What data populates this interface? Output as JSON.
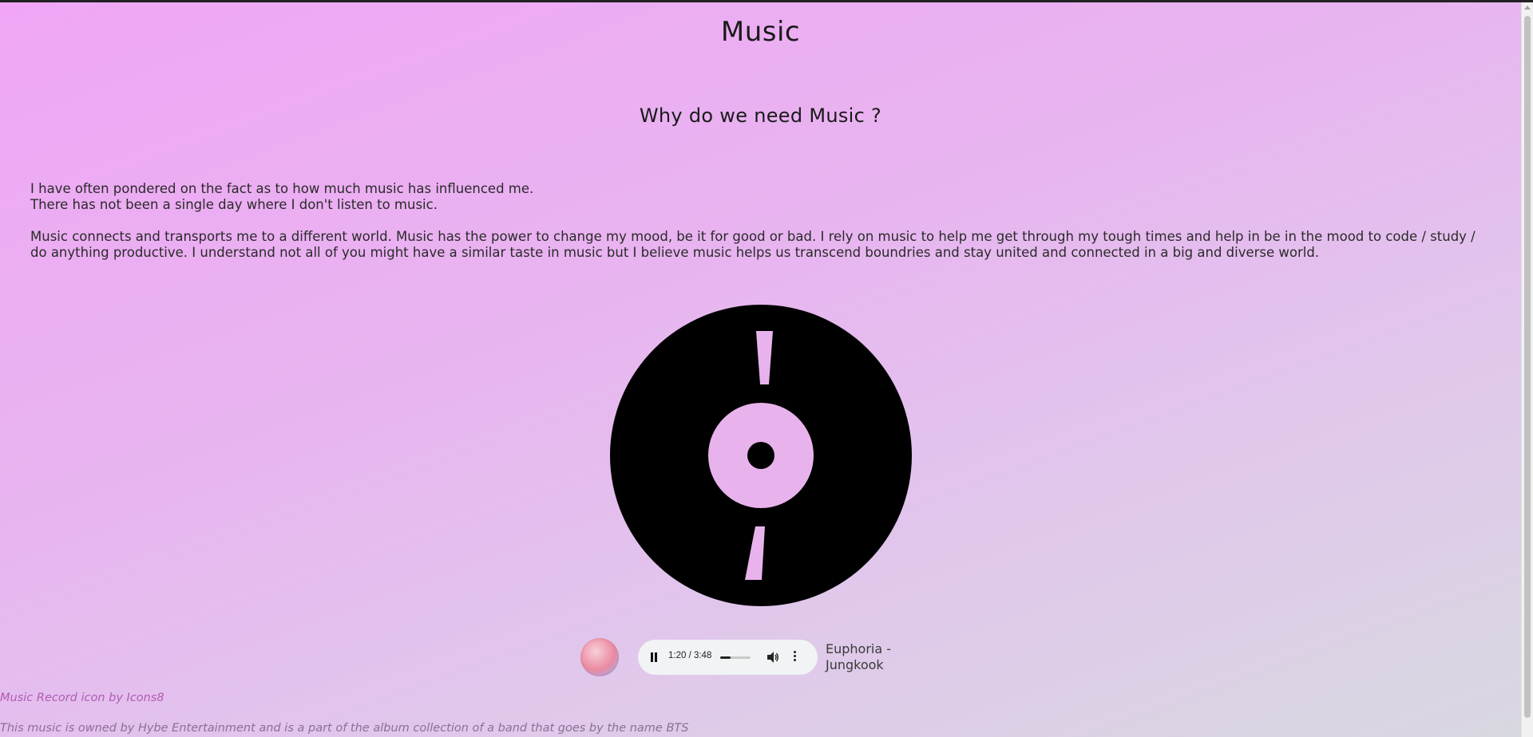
{
  "page": {
    "title": "Music",
    "subtitle": "Why do we need Music ?"
  },
  "intro": {
    "line1": "I have often pondered on the fact as to how much music has influenced me.",
    "line2": "There has not been a single day where I don't listen to music.",
    "paragraph": "Music connects and transports me to a different world. Music has the power to change my mood, be it for good or bad. I rely on music to help me get through my tough times and help in be in the mood to code / study / do anything productive. I understand not all of you might have a similar taste in music but I believe music helps us transcend boundries and stay united and connected in a big and diverse world."
  },
  "player": {
    "time": "1:20 / 3:48",
    "progress_fraction": 0.35,
    "song": "Euphoria - Jungkook",
    "pause_icon": "pause-icon",
    "volume_icon": "volume-icon",
    "more_icon": "more-options-icon"
  },
  "credits": {
    "icon_credit": "Music Record icon by Icons8",
    "ownership": "This music is owned by Hybe Entertainment and is a part of the album collection of a band that goes by the name BTS"
  },
  "colors": {
    "background_start": "#f0a6f5",
    "background_end": "#d8d8e0",
    "credit_link": "#b05bb5"
  }
}
